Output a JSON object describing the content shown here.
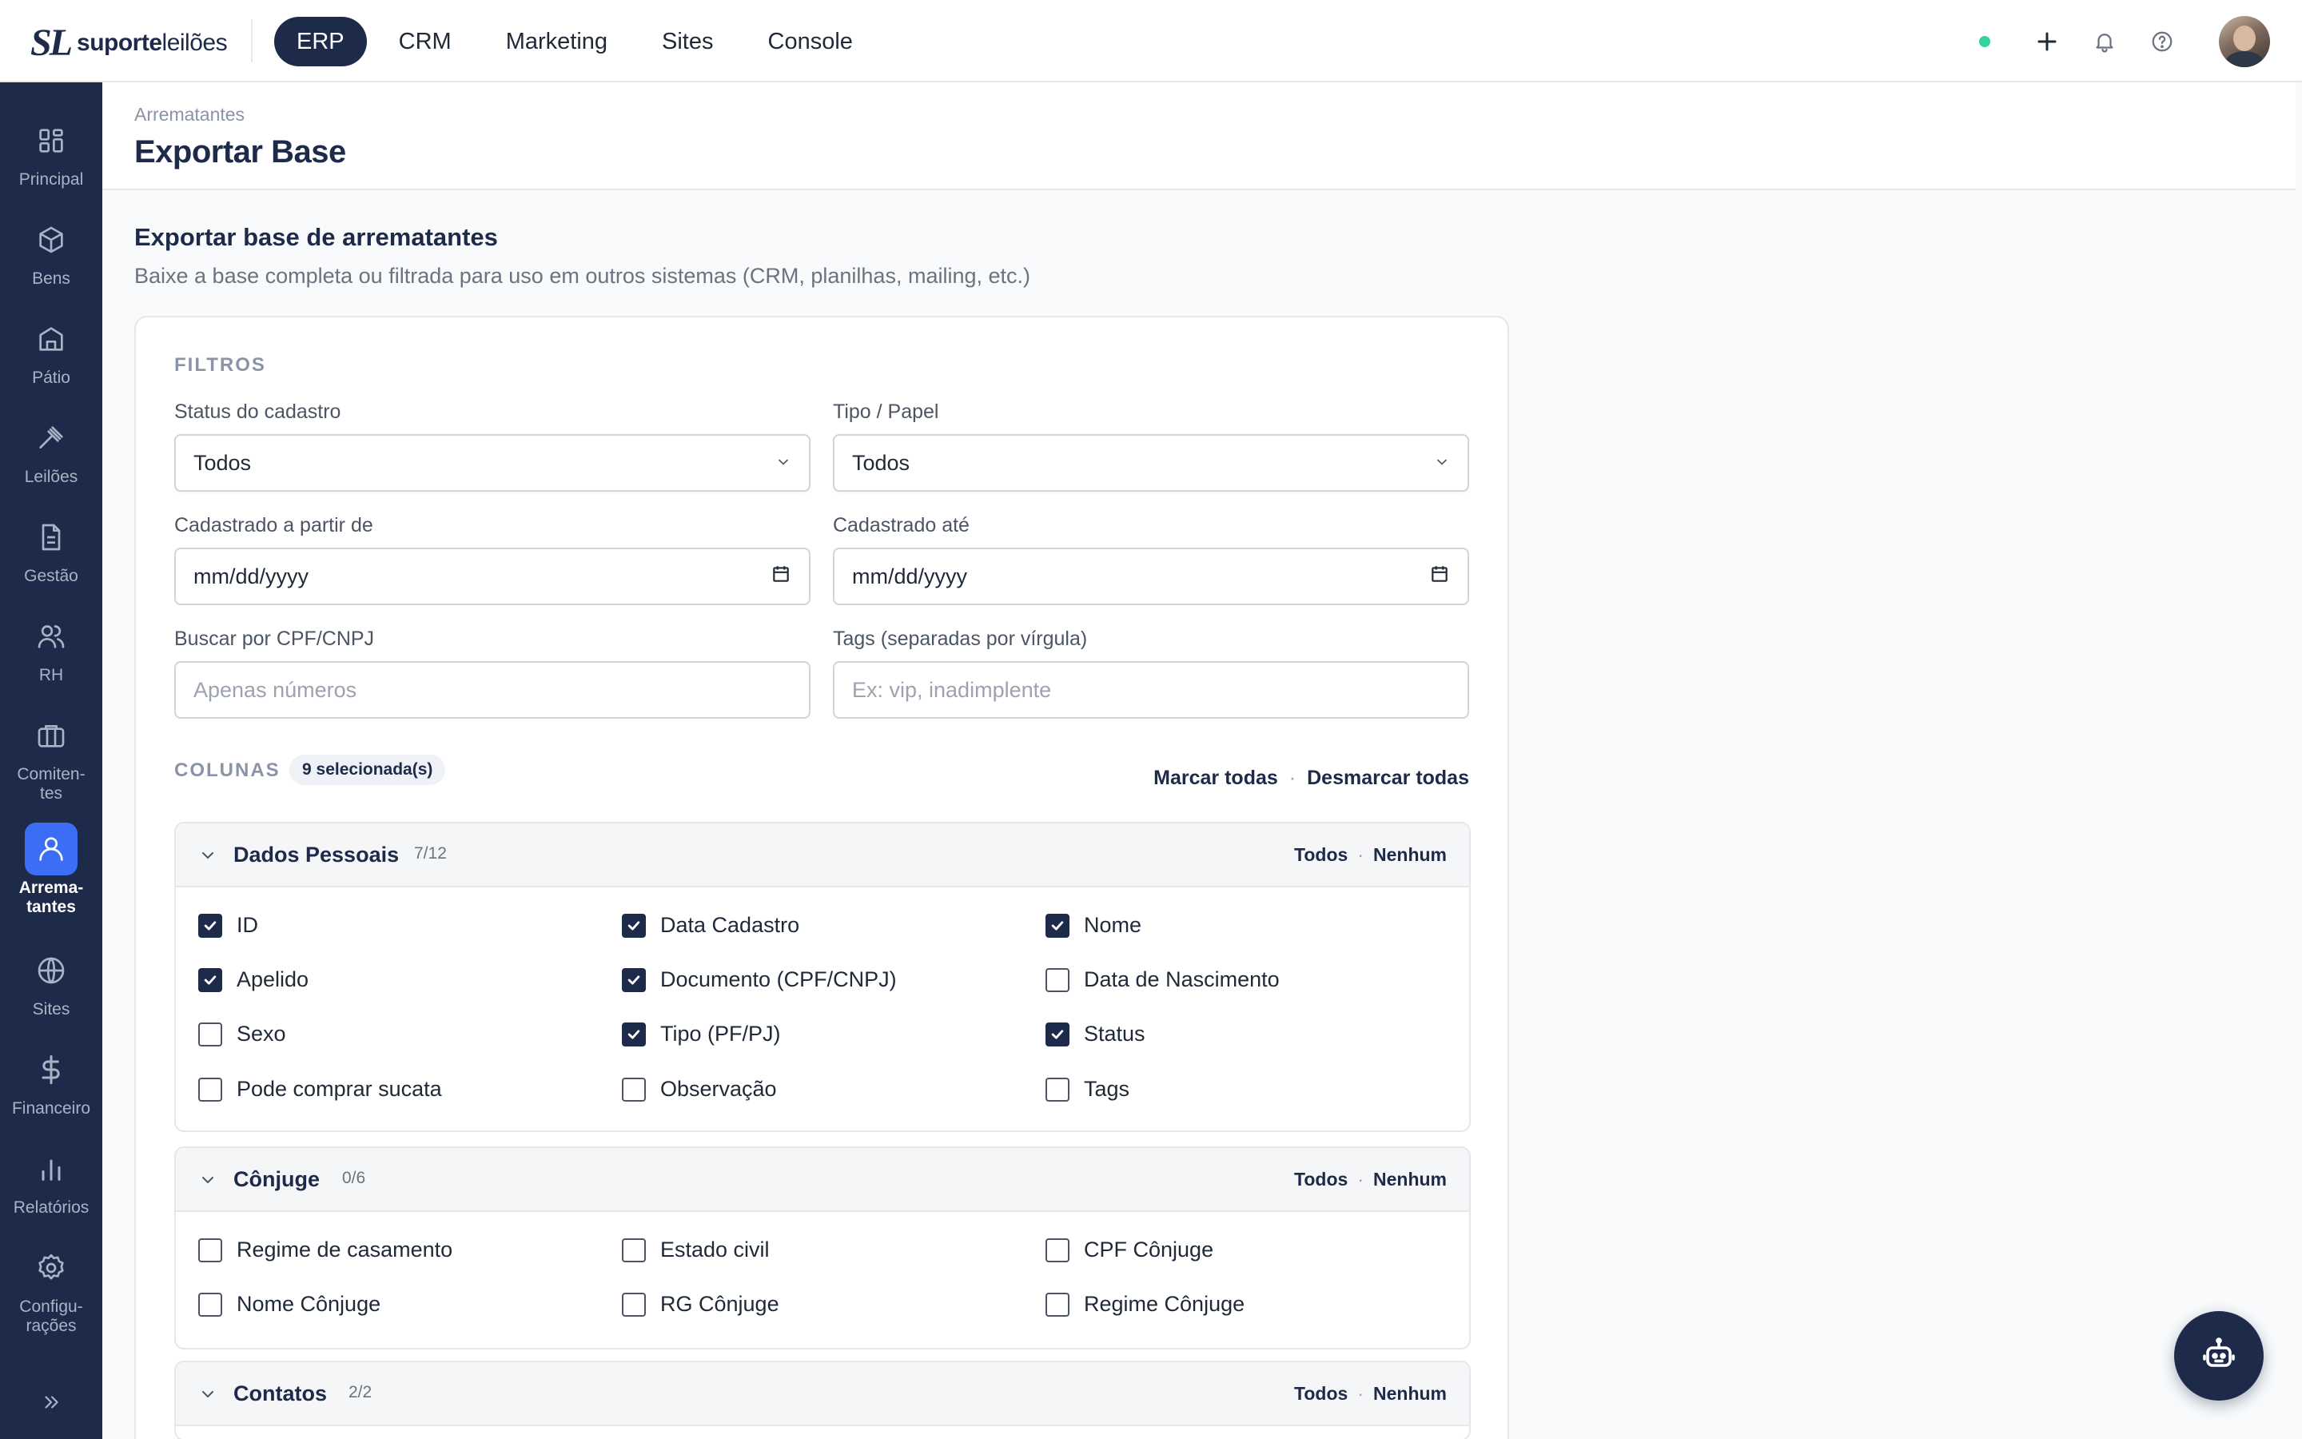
{
  "brand": {
    "mark": "SL",
    "name_bold": "suporte",
    "name_light": "leilões"
  },
  "topnav": [
    {
      "label": "ERP",
      "active": true
    },
    {
      "label": "CRM",
      "active": false
    },
    {
      "label": "Marketing",
      "active": false
    },
    {
      "label": "Sites",
      "active": false
    },
    {
      "label": "Console",
      "active": false
    }
  ],
  "sidebar": [
    {
      "label": "Principal",
      "icon": "grid-icon"
    },
    {
      "label": "Bens",
      "icon": "box-icon"
    },
    {
      "label": "Pátio",
      "icon": "warehouse-icon"
    },
    {
      "label": "Leilões",
      "icon": "gavel-icon"
    },
    {
      "label": "Gestão",
      "icon": "document-icon"
    },
    {
      "label": "RH",
      "icon": "users-icon"
    },
    {
      "label": "Comiten-\ntes",
      "icon": "briefcase-icon"
    },
    {
      "label": "Arrema-\ntantes",
      "icon": "user-icon",
      "active": true
    },
    {
      "label": "Sites",
      "icon": "globe-icon"
    },
    {
      "label": "Financeiro",
      "icon": "dollar-icon"
    },
    {
      "label": "Relatórios",
      "icon": "bar-chart-icon"
    },
    {
      "label": "Configu-\nrações",
      "icon": "gear-icon"
    }
  ],
  "page": {
    "breadcrumb": "Arrematantes",
    "title": "Exportar Base",
    "section_title": "Exportar base de arrematantes",
    "section_subtitle": "Baixe a base completa ou filtrada para uso em outros sistemas (CRM, planilhas, mailing, etc.)"
  },
  "filters": {
    "heading": "FILTROS",
    "status": {
      "label": "Status do cadastro",
      "value": "Todos"
    },
    "tipo": {
      "label": "Tipo / Papel",
      "value": "Todos"
    },
    "from": {
      "label": "Cadastrado a partir de",
      "value": "mm/dd/yyyy"
    },
    "to": {
      "label": "Cadastrado até",
      "value": "mm/dd/yyyy"
    },
    "cpf": {
      "label": "Buscar por CPF/CNPJ",
      "placeholder": "Apenas números"
    },
    "tags": {
      "label": "Tags (separadas por vírgula)",
      "placeholder": "Ex: vip, inadimplente"
    }
  },
  "columns": {
    "heading": "COLUNAS",
    "selected": "9 selecionada(s)",
    "mark_all": "Marcar todas",
    "unmark_all": "Desmarcar todas",
    "sep": "·"
  },
  "groups": [
    {
      "name": "Dados Pessoais",
      "count": "7/12",
      "all": "Todos",
      "none": "Nenhum",
      "options": [
        {
          "label": "ID",
          "checked": true
        },
        {
          "label": "Data Cadastro",
          "checked": true
        },
        {
          "label": "Nome",
          "checked": true
        },
        {
          "label": "Apelido",
          "checked": true
        },
        {
          "label": "Documento (CPF/CNPJ)",
          "checked": true
        },
        {
          "label": "Data de Nascimento",
          "checked": false
        },
        {
          "label": "Sexo",
          "checked": false
        },
        {
          "label": "Tipo (PF/PJ)",
          "checked": true
        },
        {
          "label": "Status",
          "checked": true
        },
        {
          "label": "Pode comprar sucata",
          "checked": false
        },
        {
          "label": "Observação",
          "checked": false
        },
        {
          "label": "Tags",
          "checked": false
        }
      ]
    },
    {
      "name": "Cônjuge",
      "count": "0/6",
      "all": "Todos",
      "none": "Nenhum",
      "options": [
        {
          "label": "Regime de casamento",
          "checked": false
        },
        {
          "label": "Estado civil",
          "checked": false
        },
        {
          "label": "CPF Cônjuge",
          "checked": false
        },
        {
          "label": "Nome Cônjuge",
          "checked": false
        },
        {
          "label": "RG Cônjuge",
          "checked": false
        },
        {
          "label": "Regime Cônjuge",
          "checked": false
        }
      ]
    },
    {
      "name": "Contatos",
      "count": "2/2",
      "all": "Todos",
      "none": "Nenhum",
      "options": []
    }
  ],
  "colors": {
    "navy": "#1e2a4a",
    "accent": "#3b6ef5",
    "online": "#34d399"
  }
}
